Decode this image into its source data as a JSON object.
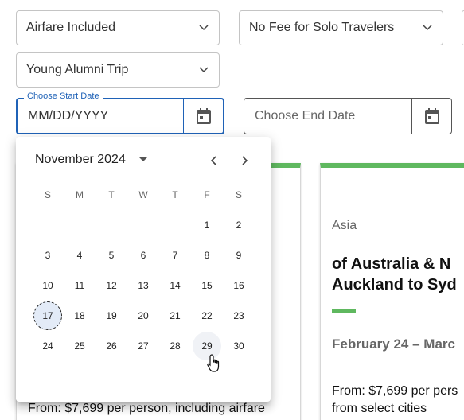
{
  "filters": {
    "airfare": "Airfare Included",
    "solo": "No Fee for Solo Travelers",
    "alumni": "Young Alumni Trip"
  },
  "start_date": {
    "label": "Choose Start Date",
    "placeholder": "MM/DD/YYYY"
  },
  "end_date": {
    "placeholder": "Choose End Date"
  },
  "calendar": {
    "month_label": "November 2024",
    "weekdays": [
      "S",
      "M",
      "T",
      "W",
      "T",
      "F",
      "S"
    ],
    "weeks": [
      [
        "",
        "",
        "",
        "",
        "",
        "1",
        "2"
      ],
      [
        "3",
        "4",
        "5",
        "6",
        "7",
        "8",
        "9"
      ],
      [
        "10",
        "11",
        "12",
        "13",
        "14",
        "15",
        "16"
      ],
      [
        "17",
        "18",
        "19",
        "20",
        "21",
        "22",
        "23"
      ],
      [
        "24",
        "25",
        "26",
        "27",
        "28",
        "29",
        "30"
      ]
    ],
    "today": "17",
    "hovered": "29"
  },
  "left_card": {
    "price": "From: $7,699 per person, including airfare"
  },
  "right_card": {
    "region": "Asia",
    "title_line1": "of Australia & N",
    "title_line2": "Auckland to Syd",
    "dates": "February 24 – Marc",
    "price_line1": "From: $7,699 per pers",
    "price_line2": "from select cities"
  },
  "colors": {
    "accent": "#1f62b7",
    "card_bar": "#5fb85f",
    "today_bg": "#e3ebf7"
  }
}
